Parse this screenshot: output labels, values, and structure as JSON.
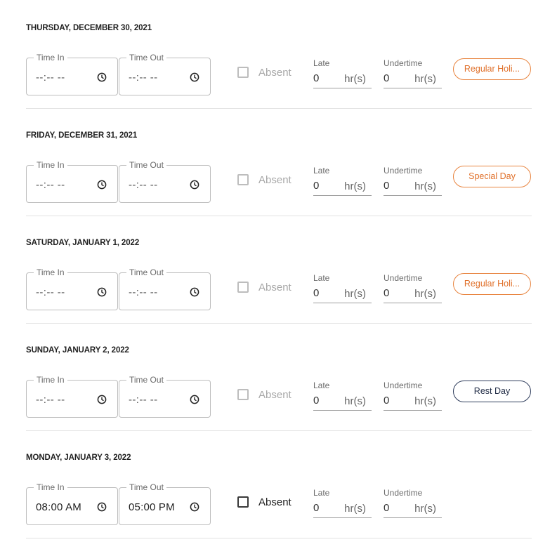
{
  "labels": {
    "time_in": "Time In",
    "time_out": "Time Out",
    "absent": "Absent",
    "late": "Late",
    "undertime": "Undertime",
    "unit": "hr(s)"
  },
  "days": [
    {
      "title": "THURSDAY, DECEMBER 30, 2021",
      "time_in": "--:-- --",
      "time_out": "--:-- --",
      "late": "0",
      "undertime": "0",
      "tag": "Regular Holi...",
      "tag_color": "#e0702a"
    },
    {
      "title": "FRIDAY, DECEMBER 31, 2021",
      "time_in": "--:-- --",
      "time_out": "--:-- --",
      "late": "0",
      "undertime": "0",
      "tag": "Special Day",
      "tag_color": "#e0702a"
    },
    {
      "title": "SATURDAY, JANUARY 1, 2022",
      "time_in": "--:-- --",
      "time_out": "--:-- --",
      "late": "0",
      "undertime": "0",
      "tag": "Regular Holi...",
      "tag_color": "#e0702a"
    },
    {
      "title": "SUNDAY, JANUARY 2, 2022",
      "time_in": "--:-- --",
      "time_out": "--:-- --",
      "late": "0",
      "undertime": "0",
      "tag": "Rest Day",
      "tag_color": "#1f2a44"
    },
    {
      "title": "MONDAY, JANUARY 3, 2022",
      "time_in": "08:00 AM",
      "time_out": "05:00 PM",
      "late": "0",
      "undertime": "0"
    }
  ]
}
